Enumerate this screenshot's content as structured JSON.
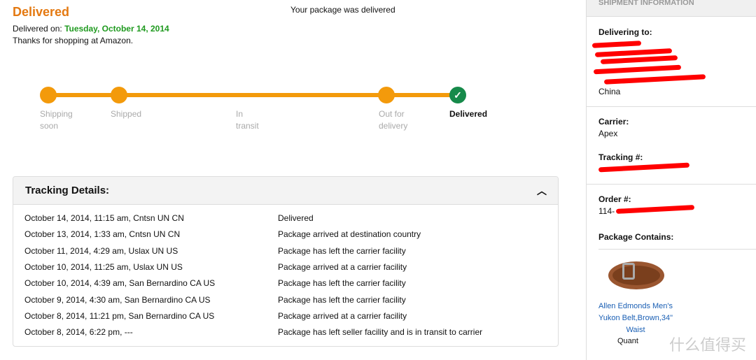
{
  "header": {
    "title": "Delivered",
    "delivered_on_label": "Delivered on:",
    "delivered_on_date": "Tuesday, October 14, 2014",
    "thanks": "Thanks for shopping at Amazon.",
    "status": "Your package was delivered"
  },
  "progress": {
    "accent": "#f39a0b",
    "done_color": "#168a4a",
    "current_step": "Delivered",
    "steps": [
      {
        "label": "Shipping soon"
      },
      {
        "label": "Shipped"
      },
      {
        "label": "In transit"
      },
      {
        "label": "Out for delivery"
      },
      {
        "label": "Delivered"
      }
    ]
  },
  "tracking": {
    "title": "Tracking Details:",
    "events": [
      {
        "when": "October 14, 2014, 11:15 am, Cntsn UN CN",
        "status": "Delivered"
      },
      {
        "when": "October 13, 2014, 1:33 am, Cntsn UN CN",
        "status": "Package arrived at destination country"
      },
      {
        "when": "October 11, 2014, 4:29 am, Uslax UN US",
        "status": "Package has left the carrier facility"
      },
      {
        "when": "October 10, 2014, 11:25 am, Uslax UN US",
        "status": "Package arrived at a carrier facility"
      },
      {
        "when": "October 10, 2014, 4:39 am, San Bernardino CA US",
        "status": "Package has left the carrier facility"
      },
      {
        "when": "October 9, 2014, 4:30 am, San Bernardino CA US",
        "status": "Package has left the carrier facility"
      },
      {
        "when": "October 8, 2014, 11:21 pm, San Bernardino CA US",
        "status": "Package arrived at a carrier facility"
      },
      {
        "when": "October 8, 2014, 6:22 pm, ---",
        "status": "Package has left seller facility and is in transit to carrier"
      }
    ]
  },
  "sidebar": {
    "title": "SHIPMENT INFORMATION",
    "delivering_label": "Delivering to:",
    "country": "China",
    "carrier_label": "Carrier:",
    "carrier": "Apex",
    "tracking_label": "Tracking #:",
    "order_label": "Order #:",
    "order_prefix": "114-",
    "contains_label": "Package Contains:",
    "product": "Allen Edmonds Men's Yukon Belt,Brown,34\" Waist",
    "quantity": "Quant"
  },
  "watermark": "什么值得买"
}
